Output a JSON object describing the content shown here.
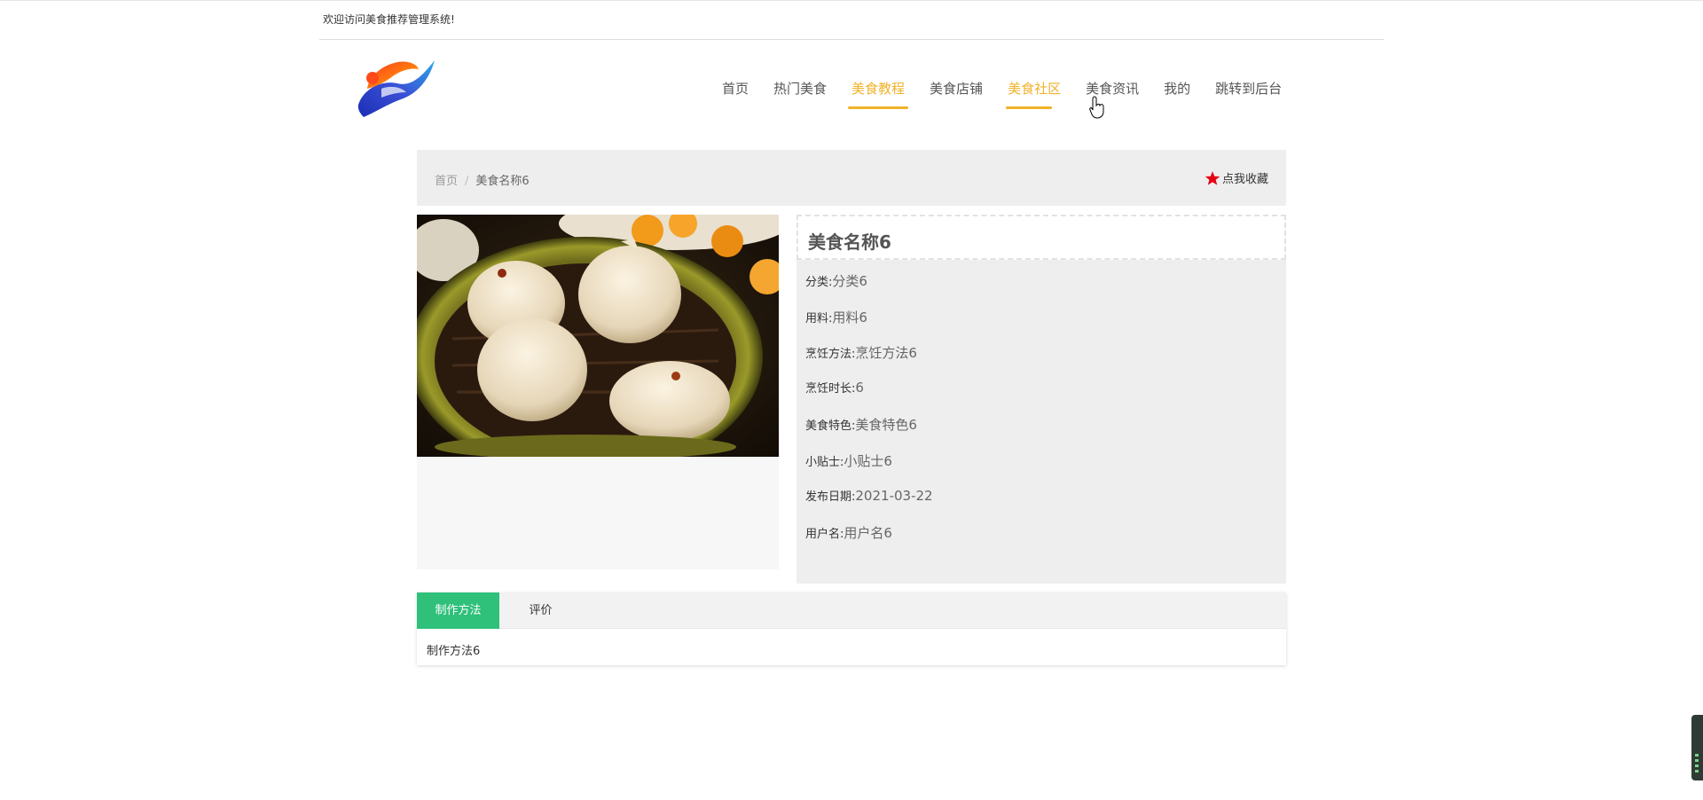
{
  "welcome": {
    "text": "欢迎访问美食推荐管理系统!"
  },
  "logo": {
    "icon": "brand-logo-icon"
  },
  "nav": {
    "items": [
      {
        "label": "首页"
      },
      {
        "label": "热门美食"
      },
      {
        "label": "美食教程"
      },
      {
        "label": "美食店铺"
      },
      {
        "label": "美食社区"
      },
      {
        "label": "美食资讯"
      },
      {
        "label": "我的"
      },
      {
        "label": "跳转到后台"
      }
    ],
    "active_index": 2,
    "hover_index": 4
  },
  "breadcrumb": {
    "home": "首页",
    "separator": "/",
    "current": "美食名称6"
  },
  "favorite": {
    "label": "点我收藏",
    "icon": "star-icon"
  },
  "detail": {
    "title": "美食名称6",
    "fields": [
      {
        "label": "分类:",
        "value": "分类6"
      },
      {
        "label": "用料:",
        "value": "用料6"
      },
      {
        "label": "烹饪方法:",
        "value": "烹饪方法6"
      },
      {
        "label": "烹饪时长:",
        "value": "6"
      },
      {
        "label": "美食特色:",
        "value": "美食特色6"
      },
      {
        "label": "小贴士:",
        "value": "小贴士6"
      },
      {
        "label": "发布日期:",
        "value": "2021-03-22"
      },
      {
        "label": "用户名:",
        "value": "用户名6"
      }
    ]
  },
  "tabs": {
    "items": [
      {
        "label": "制作方法"
      },
      {
        "label": "评价"
      }
    ],
    "active_index": 0,
    "content": "制作方法6"
  },
  "colors": {
    "accent": "#f0b229",
    "tab_active": "#2fc07a",
    "star": "#e60012",
    "panel_bg": "#eeeeee"
  }
}
